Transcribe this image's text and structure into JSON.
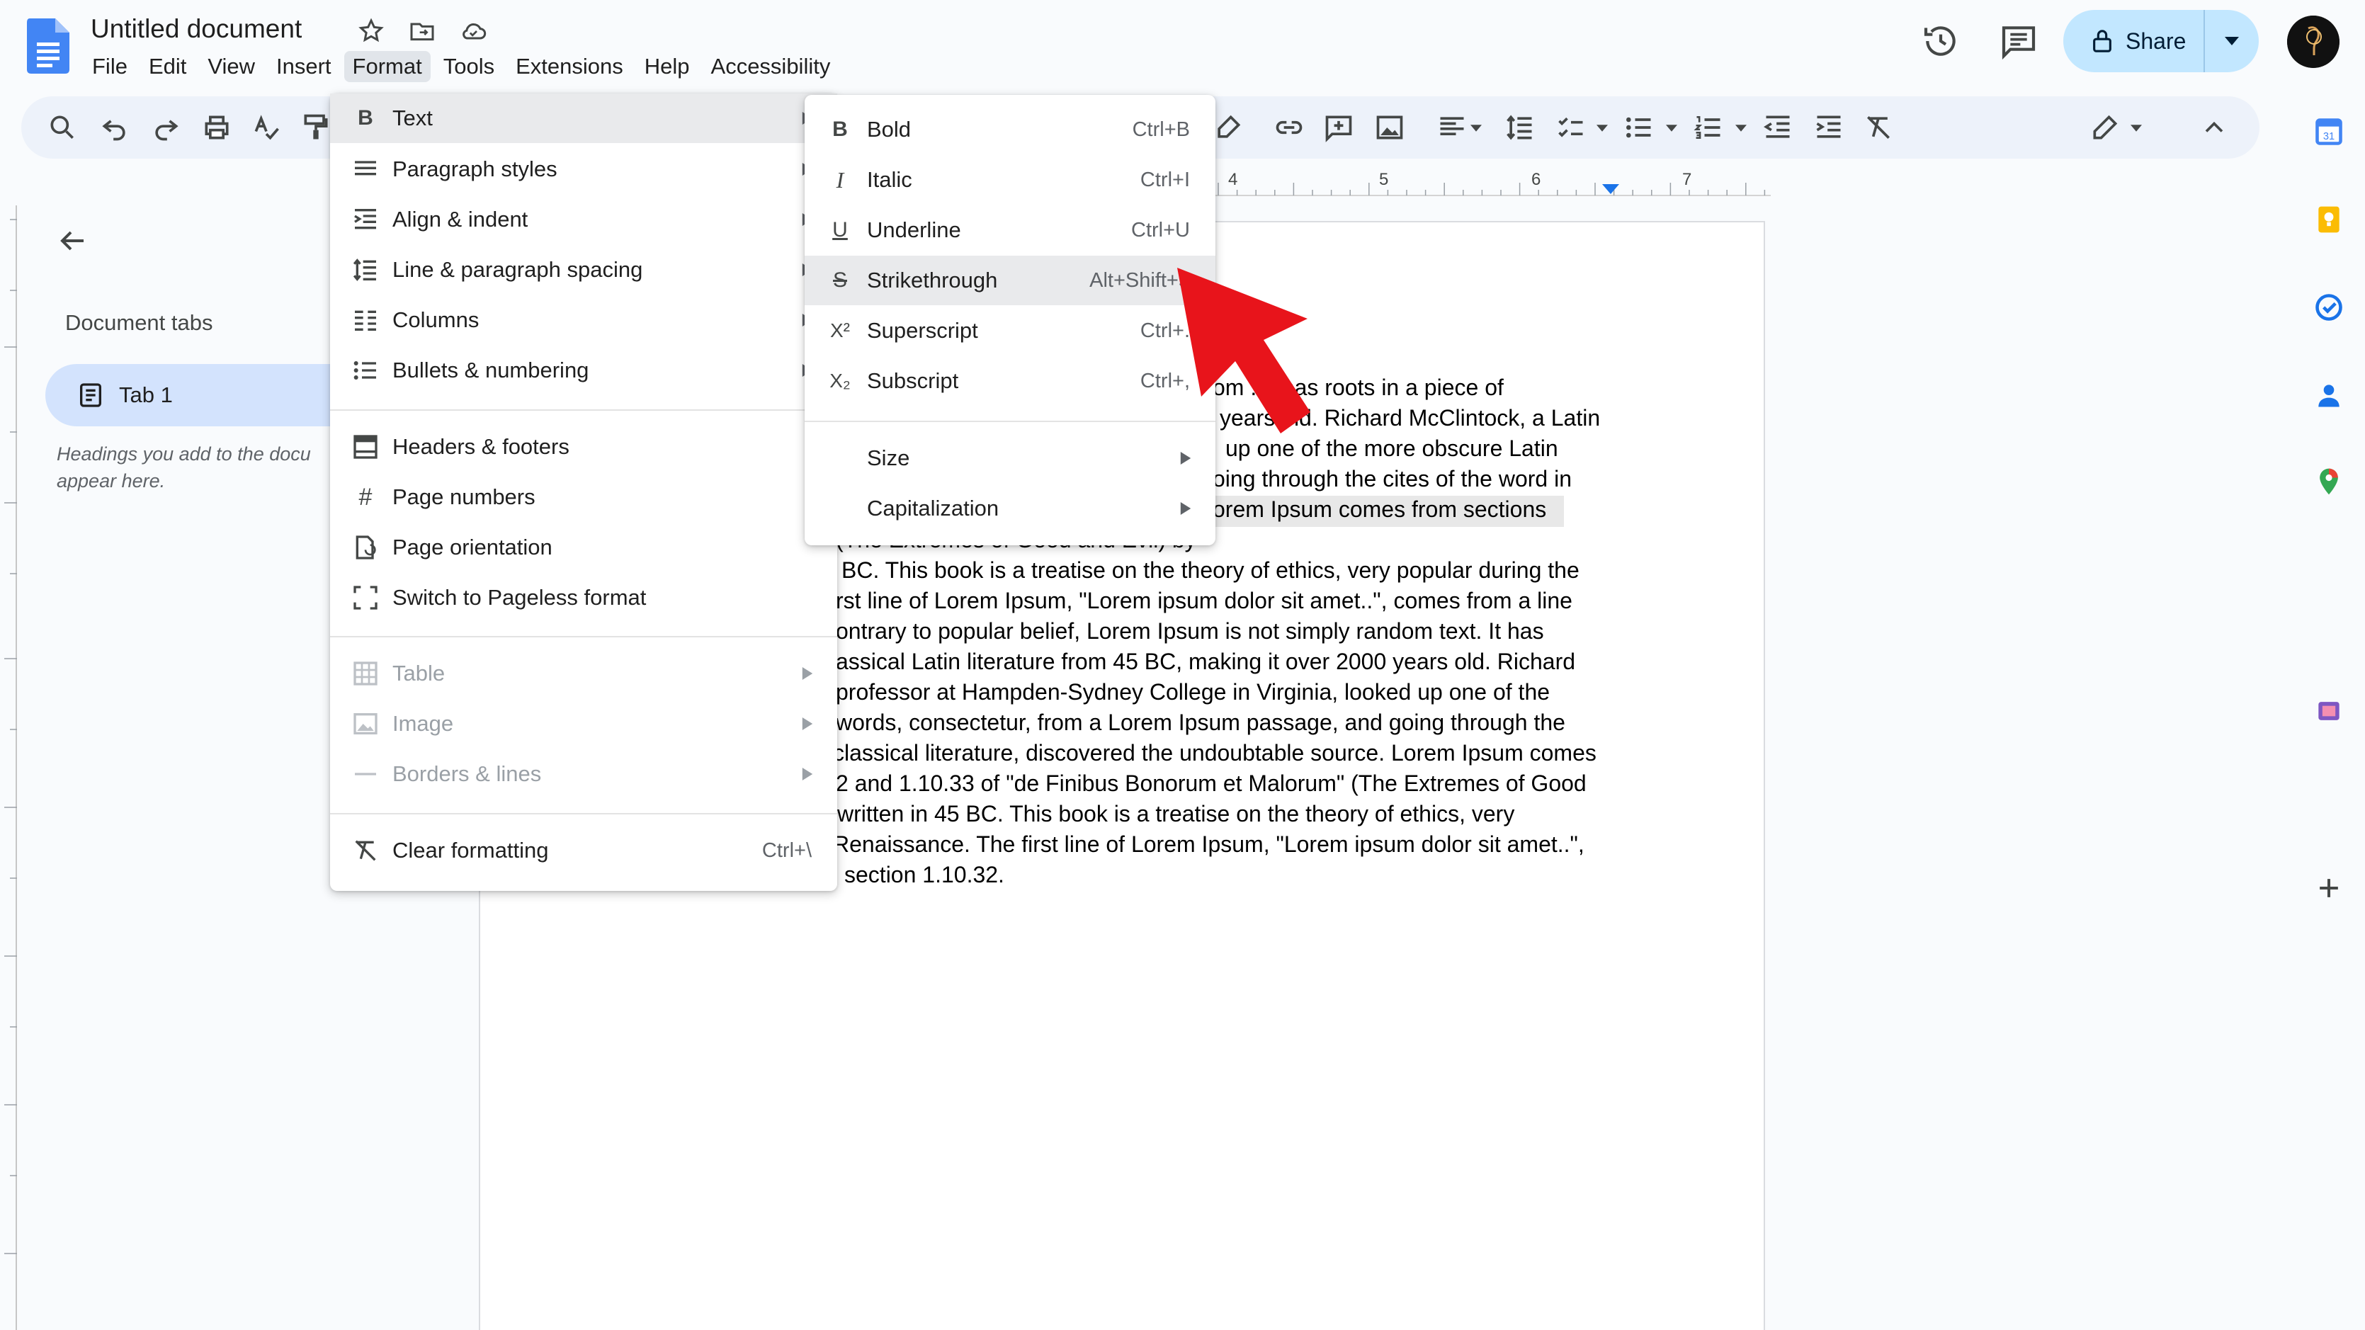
{
  "header": {
    "doc_title": "Untitled document",
    "menus": [
      "File",
      "Edit",
      "View",
      "Insert",
      "Format",
      "Tools",
      "Extensions",
      "Help",
      "Accessibility"
    ],
    "active_menu": "Format",
    "share_label": "Share"
  },
  "sidebar": {
    "section_title": "Document tabs",
    "tab_label": "Tab 1",
    "hint_line1": "Headings you add to the docu",
    "hint_line2": "appear here."
  },
  "ruler": {
    "ticks": [
      "4",
      "5",
      "6",
      "7"
    ]
  },
  "format_menu": {
    "items": [
      {
        "label": "Text",
        "icon": "bold-b-icon",
        "submenu": true
      },
      {
        "label": "Paragraph styles",
        "icon": "paragraph-styles-icon",
        "submenu": true
      },
      {
        "label": "Align & indent",
        "icon": "align-indent-icon",
        "submenu": true
      },
      {
        "label": "Line & paragraph spacing",
        "icon": "line-spacing-icon",
        "submenu": true
      },
      {
        "label": "Columns",
        "icon": "columns-icon",
        "submenu": true
      },
      {
        "label": "Bullets & numbering",
        "icon": "bullets-icon",
        "submenu": true
      },
      {
        "label": "Headers & footers",
        "icon": "headers-footers-icon"
      },
      {
        "label": "Page numbers",
        "icon": "hash-icon"
      },
      {
        "label": "Page orientation",
        "icon": "page-orientation-icon"
      },
      {
        "label": "Switch to Pageless format",
        "icon": "pageless-icon"
      },
      {
        "label": "Table",
        "icon": "table-icon",
        "submenu": true,
        "disabled": true
      },
      {
        "label": "Image",
        "icon": "image-icon",
        "submenu": true,
        "disabled": true
      },
      {
        "label": "Borders & lines",
        "icon": "borders-icon",
        "submenu": true,
        "disabled": true
      },
      {
        "label": "Clear formatting",
        "icon": "clear-formatting-icon",
        "shortcut": "Ctrl+\\"
      }
    ]
  },
  "text_submenu": {
    "items": [
      {
        "label": "Bold",
        "glyph": "B",
        "shortcut": "Ctrl+B"
      },
      {
        "label": "Italic",
        "glyph": "I",
        "shortcut": "Ctrl+I"
      },
      {
        "label": "Underline",
        "glyph": "U",
        "shortcut": "Ctrl+U"
      },
      {
        "label": "Strikethrough",
        "glyph": "S",
        "shortcut": "Alt+Shift+5"
      },
      {
        "label": "Superscript",
        "glyph": "X²",
        "shortcut": "Ctrl+."
      },
      {
        "label": "Subscript",
        "glyph": "X₂",
        "shortcut": "Ctrl+,"
      },
      {
        "label": "Size",
        "submenu": true
      },
      {
        "label": "Capitalization",
        "submenu": true
      }
    ]
  },
  "document": {
    "lines": [
      "om       . It has roots in a piece of",
      "years old. Richard McClintock, a Latin",
      "up one of the more obscure Latin",
      "oing through the cites of the word in",
      "orem Ipsum comes from sections",
      "                                      (The Extremes of Good and Evil) by",
      "BC. This book is a treatise on the theory of ethics, very popular during the",
      "rst line of Lorem Ipsum, \"Lorem ipsum dolor sit amet..\", comes from a line",
      "ontrary to popular belief, Lorem Ipsum is not simply random text. It has",
      "assical Latin literature from 45 BC, making it over 2000 years old. Richard",
      "professor at Hampden-Sydney College in Virginia, looked up one of the",
      "words, consectetur, from a Lorem Ipsum passage, and going through the",
      "classical literature, discovered the undoubtable source. Lorem Ipsum comes",
      "2 and 1.10.33 of \"de Finibus Bonorum et Malorum\" (The Extremes of Good",
      "written in 45 BC. This book is a treatise on the theory of ethics, very",
      "Renaissance. The first line of Lorem Ipsum, \"Lorem ipsum dolor sit amet..\",",
      "section 1.10.32."
    ]
  },
  "colors": {
    "accent": "#0b57d0",
    "share_bg": "#c2e7ff",
    "annotation_arrow": "#e8141b"
  }
}
